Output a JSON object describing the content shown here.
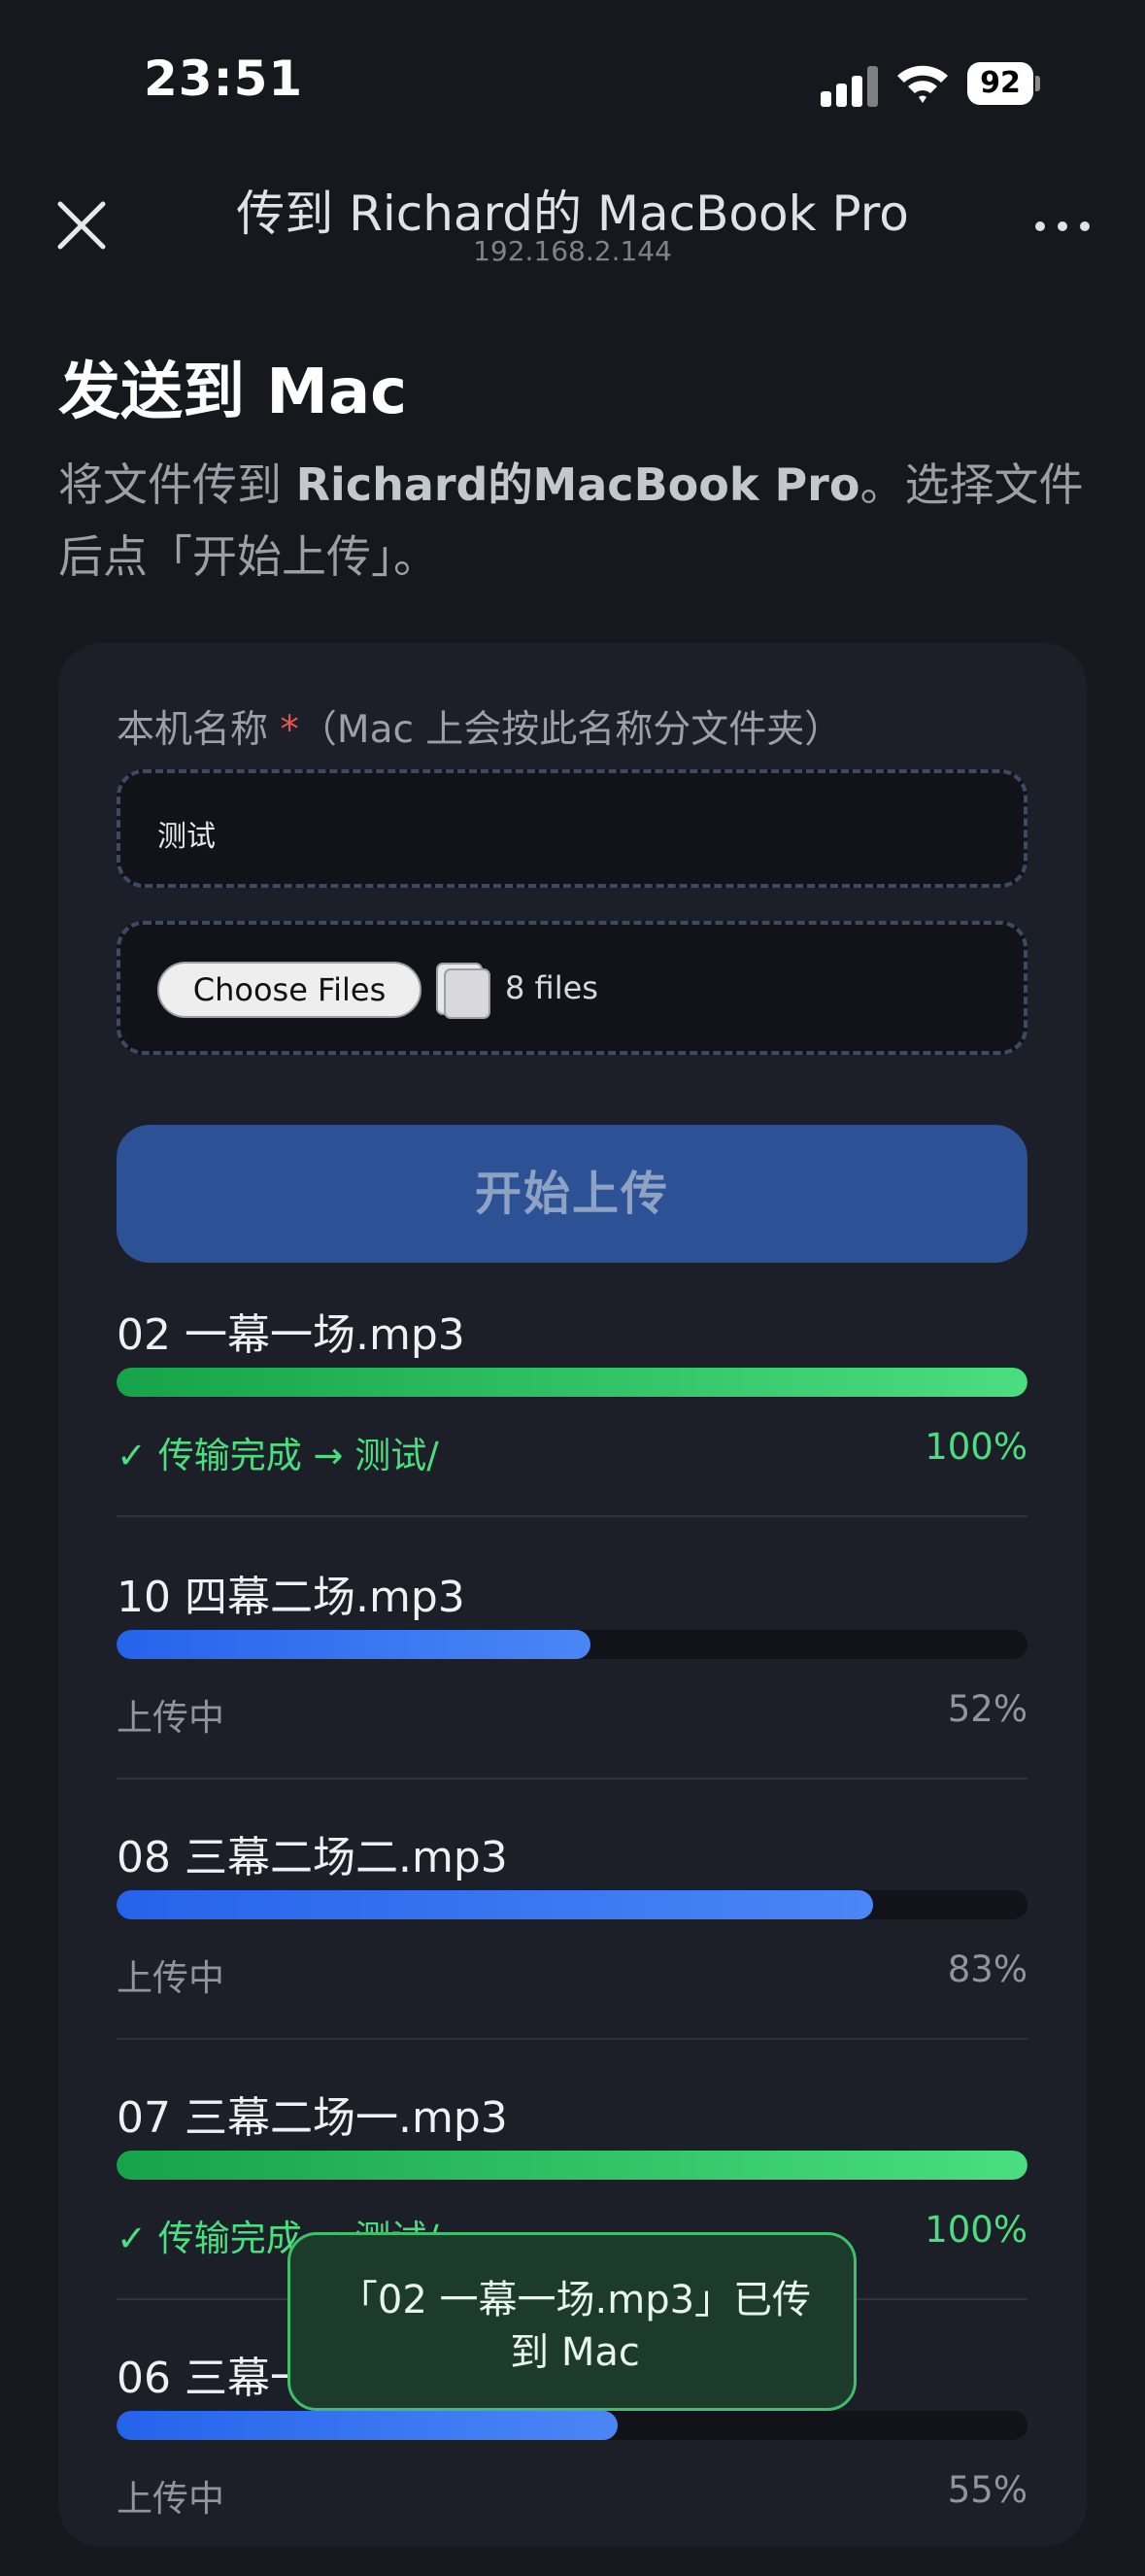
{
  "status_bar": {
    "time": "23:51",
    "battery": "92"
  },
  "header": {
    "title": "传到 Richard的 MacBook Pro",
    "subtitle": "192.168.2.144"
  },
  "page": {
    "title": "发送到 Mac",
    "desc_prefix": "将文件传到 ",
    "desc_device": "Richard的MacBook Pro",
    "desc_suffix": "。选择文件后点「开始上传」。"
  },
  "form": {
    "name_label": "本机名称",
    "required_mark": "*",
    "name_hint": "（Mac 上会按此名称分文件夹）",
    "name_value": "测试",
    "choose_files_label": "Choose Files",
    "files_count": "8 files",
    "upload_button_label": "开始上传"
  },
  "uploads": [
    {
      "name": "02 一幕一场.mp3",
      "progress": 1.0,
      "status": "✓ 传输完成 → 测试/",
      "percent": "100%",
      "state": "done"
    },
    {
      "name": "10 四幕二场.mp3",
      "progress": 0.52,
      "status": "上传中",
      "percent": "52%",
      "state": "active"
    },
    {
      "name": "08 三幕二场二.mp3",
      "progress": 0.83,
      "status": "上传中",
      "percent": "83%",
      "state": "active"
    },
    {
      "name": "07 三幕二场一.mp3",
      "progress": 1.0,
      "status": "✓ 传输完成 → 测试/",
      "percent": "100%",
      "state": "done"
    },
    {
      "name": "06 三幕一场.mp3",
      "progress": 0.55,
      "status": "上传中",
      "percent": "55%",
      "state": "active"
    }
  ],
  "toast": {
    "text": "「02 一幕一场.mp3」已传到 Mac"
  },
  "colors": {
    "accent": "#2c5194",
    "success": "#4ade80",
    "progress_blue": "#2563eb",
    "background": "#16181d"
  }
}
